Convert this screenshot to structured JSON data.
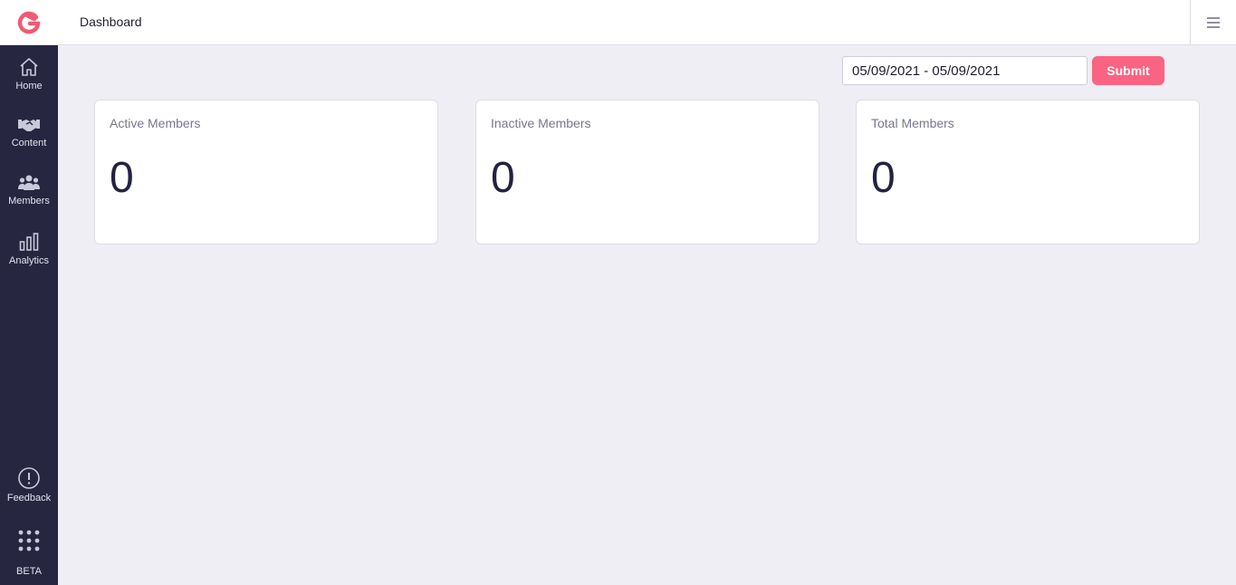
{
  "header": {
    "title": "Dashboard"
  },
  "sidebar": {
    "items": [
      {
        "label": "Home",
        "icon": "home-icon"
      },
      {
        "label": "Content",
        "icon": "handshake-icon"
      },
      {
        "label": "Members",
        "icon": "members-icon"
      },
      {
        "label": "Analytics",
        "icon": "analytics-icon"
      }
    ],
    "bottom_items": [
      {
        "label": "Feedback",
        "icon": "feedback-icon"
      },
      {
        "label": "BETA",
        "icon": "apps-grid-icon"
      }
    ]
  },
  "filter": {
    "date_range": "05/09/2021 - 05/09/2021",
    "submit_label": "Submit"
  },
  "stats": [
    {
      "title": "Active Members",
      "value": "0"
    },
    {
      "title": "Inactive Members",
      "value": "0"
    },
    {
      "title": "Total Members",
      "value": "0"
    }
  ],
  "colors": {
    "sidebar_bg": "#272641",
    "accent": "#fb6383",
    "page_bg": "#efeef4"
  }
}
